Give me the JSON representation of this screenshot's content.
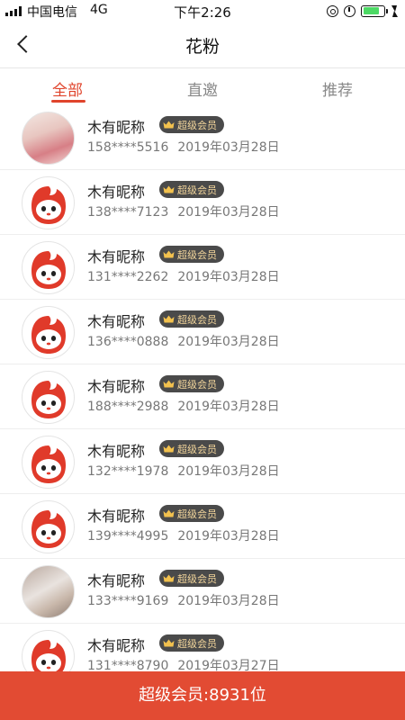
{
  "status_bar": {
    "carrier": "中国电信",
    "network": "4G",
    "time": "下午2:26",
    "battery_level": 0.8
  },
  "navbar": {
    "title": "花粉"
  },
  "tabs": [
    {
      "label": "全部",
      "active": true
    },
    {
      "label": "直邀",
      "active": false
    },
    {
      "label": "推荐",
      "active": false
    }
  ],
  "members": [
    {
      "name": "木有昵称",
      "badge": "超级会员",
      "phone": "158****5516",
      "date": "2019年03月28日",
      "avatar": "photo-illustration"
    },
    {
      "name": "木有昵称",
      "badge": "超级会员",
      "phone": "138****7123",
      "date": "2019年03月28日",
      "avatar": "mascot"
    },
    {
      "name": "木有昵称",
      "badge": "超级会员",
      "phone": "131****2262",
      "date": "2019年03月28日",
      "avatar": "mascot"
    },
    {
      "name": "木有昵称",
      "badge": "超级会员",
      "phone": "136****0888",
      "date": "2019年03月28日",
      "avatar": "mascot"
    },
    {
      "name": "木有昵称",
      "badge": "超级会员",
      "phone": "188****2988",
      "date": "2019年03月28日",
      "avatar": "mascot"
    },
    {
      "name": "木有昵称",
      "badge": "超级会员",
      "phone": "132****1978",
      "date": "2019年03月28日",
      "avatar": "mascot"
    },
    {
      "name": "木有昵称",
      "badge": "超级会员",
      "phone": "139****4995",
      "date": "2019年03月28日",
      "avatar": "mascot"
    },
    {
      "name": "木有昵称",
      "badge": "超级会员",
      "phone": "133****9169",
      "date": "2019年03月28日",
      "avatar": "photo-person"
    },
    {
      "name": "木有昵称",
      "badge": "超级会员",
      "phone": "131****8790",
      "date": "2019年03月27日",
      "avatar": "mascot"
    }
  ],
  "footer": {
    "text": "超级会员:8931位"
  },
  "colors": {
    "accent": "#e0442c",
    "badge_bg": "#4a4a4a",
    "badge_text": "#f2d59b",
    "footer_bg": "#e24b33"
  }
}
